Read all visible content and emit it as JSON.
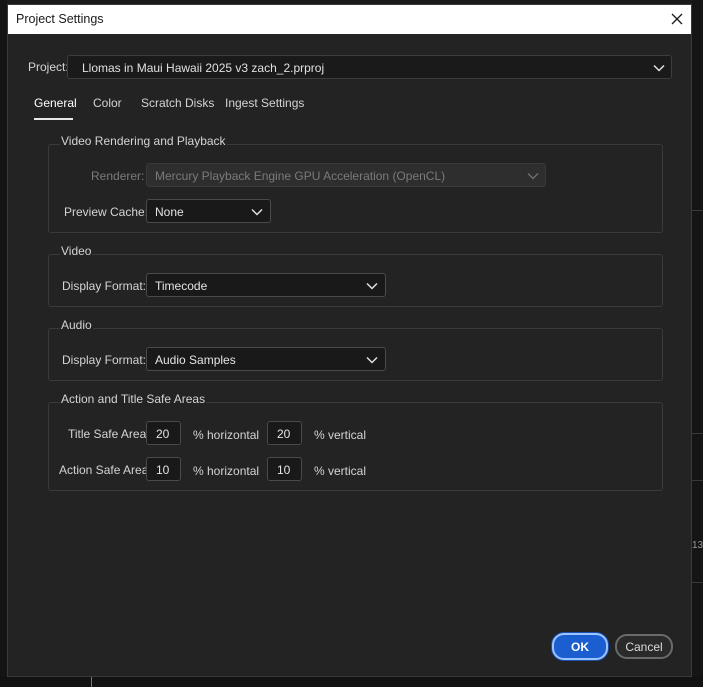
{
  "window": {
    "title": "Project Settings"
  },
  "project": {
    "label": "Project:",
    "value": "Llomas in Maui Hawaii 2025 v3 zach_2.prproj"
  },
  "tabs": [
    {
      "label": "General",
      "active": true
    },
    {
      "label": "Color",
      "active": false
    },
    {
      "label": "Scratch Disks",
      "active": false
    },
    {
      "label": "Ingest Settings",
      "active": false
    }
  ],
  "video_rendering": {
    "title": "Video Rendering and Playback",
    "renderer_label": "Renderer:",
    "renderer_value": "Mercury Playback Engine GPU Acceleration (OpenCL)",
    "preview_cache_label": "Preview Cache:",
    "preview_cache_value": "None"
  },
  "video": {
    "title": "Video",
    "display_format_label": "Display Format:",
    "display_format_value": "Timecode"
  },
  "audio": {
    "title": "Audio",
    "display_format_label": "Display Format:",
    "display_format_value": "Audio Samples"
  },
  "safe_areas": {
    "title": "Action and Title Safe Areas",
    "title_safe_label": "Title Safe Area",
    "title_safe_horizontal": "20",
    "title_safe_vertical": "20",
    "action_safe_label": "Action Safe Area",
    "action_safe_horizontal": "10",
    "action_safe_vertical": "10",
    "horizontal_unit": "% horizontal",
    "vertical_unit": "% vertical"
  },
  "buttons": {
    "ok": "OK",
    "cancel": "Cancel"
  },
  "background": {
    "right_glyph_top": "13"
  },
  "colors": {
    "accent": "#1a5ed0",
    "dialog_bg": "#232323",
    "titlebar_bg": "#ffffff"
  }
}
